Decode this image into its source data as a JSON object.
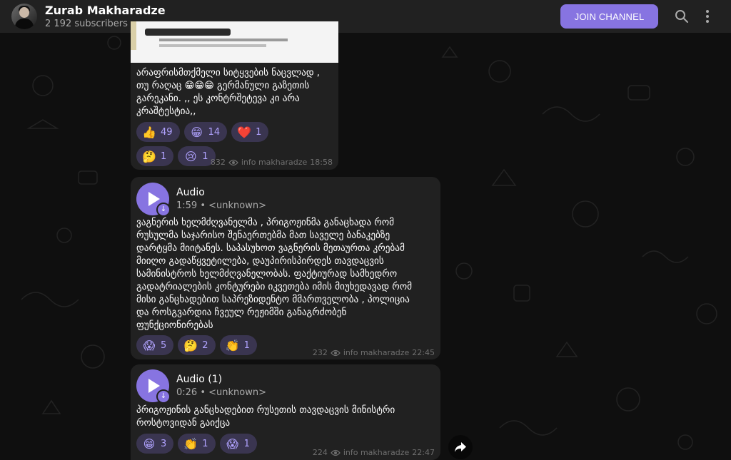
{
  "channel": {
    "name": "Zurab Makharadze",
    "subscribers": "2 192 subscribers",
    "join_label": "JOIN CHANNEL"
  },
  "icons": {
    "search": "search-icon",
    "more": "more-vertical-icon",
    "views": "eye-icon",
    "share": "share-icon",
    "play": "play-icon",
    "download": "download-icon"
  },
  "colors": {
    "accent": "#8774e1",
    "bubble": "#212121",
    "reaction_bg": "#3a3550",
    "reaction_text": "#b1a3ff",
    "background": "#0f0f0f"
  },
  "messages": [
    {
      "text": "არაფრისმთქმელი სიტყვების ნაცვლად ,\nთუ რაღაც 😁😁😁 გერმანული გაზეთის\nგარეკანი. ,, ეს კონტრშეტევა კი არა\nკრაშტესტია,,",
      "reactions": [
        {
          "emoji": "👍",
          "count": "49"
        },
        {
          "emoji": "😁",
          "count": "14"
        },
        {
          "emoji": "❤️",
          "count": "1"
        },
        {
          "emoji": "🤔",
          "count": "1"
        },
        {
          "emoji": "😢",
          "count": "1"
        }
      ],
      "views": "832",
      "author": "info makharadze",
      "time": "18:58"
    },
    {
      "audio_title": "Audio",
      "audio_meta": "1:59 • <unknown>",
      "text": "ვაგნერის ხელმძღვანელმა , პრიგოჟინმა განაცხადა რომ\nრუსულმა საჯარისო შენაერთებმა მათ საველე ბანაკებზე\nდარტყმა მიიტანეს. საპასუხოთ ვაგნერის მეთაურთა კრებამ\nმიიღო გადაწყვეტილება, დაუპირისპირდეს თავდაცვის\nსამინისტროს ხელმძღვანელობას.  ფაქტიურად სამხედრო\nგადატრიალების კონტურები იკვეთება იმის მიუხედავად რომ\nმისი განცხადებით საპრეზიდენტო მმართველობა , პოლიცია\nდა როსგვარდია ჩვეულ რეჟიმში განაგრძობენ\nფუნქციონირებას",
      "reactions": [
        {
          "emoji": "😱",
          "count": "5"
        },
        {
          "emoji": "🤔",
          "count": "2"
        },
        {
          "emoji": "👏",
          "count": "1"
        }
      ],
      "views": "232",
      "author": "info makharadze",
      "time": "22:45"
    },
    {
      "audio_title": "Audio (1)",
      "audio_meta": "0:26 • <unknown>",
      "text": "პრიგოჟინის განცხადებით რუსეთის თავდაცვის მინისტრი\nროსტოვიდან გაიქცა",
      "reactions": [
        {
          "emoji": "😁",
          "count": "3"
        },
        {
          "emoji": "👏",
          "count": "1"
        },
        {
          "emoji": "😱",
          "count": "1"
        }
      ],
      "views": "224",
      "author": "info makharadze",
      "time": "22:47"
    }
  ]
}
